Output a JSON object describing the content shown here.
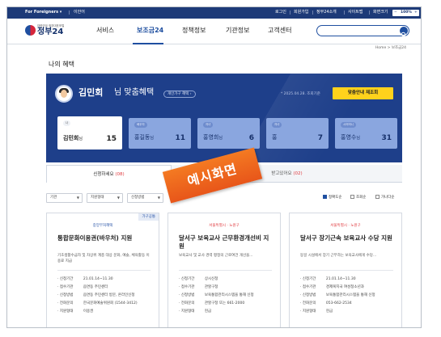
{
  "topbar": {
    "foreigners": "For Foreigners ▾",
    "easy": "이안어",
    "links": [
      "로그인",
      "회원가입",
      "정부24소개",
      "사이트맵"
    ],
    "zoom_label": "화면크기",
    "zoom_minus": "−",
    "zoom_value": "100%",
    "zoom_plus": "+"
  },
  "header": {
    "logo_small": "대한민국 정부대표포털",
    "logo_text": "정부24",
    "nav": [
      "서비스",
      "보조금24",
      "정책정보",
      "기관정보",
      "고객센터"
    ],
    "active_nav": "보조금24"
  },
  "breadcrumb": "Home > 보조금24",
  "page_title": "나의 혜택",
  "banner": {
    "name": "김민회",
    "suffix": "님 맞춤혜택",
    "badge": "개인가구 혜택 ›",
    "date": "* 2025.04.28. 조회기준",
    "button": "맞춤안내 재조회",
    "members": [
      {
        "tag": "나",
        "name": "김민회",
        "honorific": "님",
        "count": "15"
      },
      {
        "tag": "배우자",
        "name": "홍길동",
        "honorific": "님",
        "count": "11"
      },
      {
        "tag": "자녀",
        "name": "홍영희",
        "honorific": "님",
        "count": "6"
      },
      {
        "tag": "자녀",
        "name": "홍",
        "honorific": "",
        "count": "7"
      },
      {
        "tag": "시어머니",
        "name": "홍영수",
        "honorific": "님",
        "count": "31"
      }
    ]
  },
  "tabs": {
    "left": "신청하세요",
    "left_count": "(08)",
    "right": "받고있어요",
    "right_count": "(02)"
  },
  "stamp": "예시화면",
  "filters": [
    "기관",
    "지원형태",
    "신청방법"
  ],
  "checks": [
    {
      "label": "정확도순",
      "checked": true
    },
    {
      "label": "조회순",
      "checked": false
    },
    {
      "label": "가나다순",
      "checked": false
    }
  ],
  "cards": [
    {
      "badge": "가구공통",
      "org": "중앙부처혜택",
      "title": "통합문화이용권(바우처) 지원",
      "desc": "기초생활수급자 및 차상위 계층 대상 문화, 예술, 체육활동 이용료 지급",
      "rows": [
        {
          "k": "신청기간",
          "v": "21.01.14~11.30"
        },
        {
          "k": "접수기관",
          "v": "읍면동 주민센터"
        },
        {
          "k": "신청방법",
          "v": "읍면동 주민센터 방문, 온라인신청"
        },
        {
          "k": "전화문의",
          "v": "한국문화예술위원회 (1544-3412)"
        },
        {
          "k": "지원형태",
          "v": "이용권"
        }
      ]
    },
    {
      "badge": "",
      "org": "서울특별시 · 노원구",
      "title": "달서구 보육교사 근무환경개선비 지원",
      "desc": "보육교사 및 교사 경력 평정의 근로여건 개선을...",
      "rows": [
        {
          "k": "신청기간",
          "v": "상시신청"
        },
        {
          "k": "접수기관",
          "v": "관할구청"
        },
        {
          "k": "신청방법",
          "v": "보육통합관리시스템을 통해 신청"
        },
        {
          "k": "전화문의",
          "v": "관할구청 또는 661-2000"
        },
        {
          "k": "지원형태",
          "v": "현금"
        }
      ]
    },
    {
      "badge": "",
      "org": "서울특별시 · 노원구",
      "title": "달서구 장기근속 보육교사 수당 지원",
      "desc": "동일 시설에서 장기 근무하는 보육교사에게 수당...",
      "rows": [
        {
          "k": "신청기간",
          "v": "21.01.14~11.30"
        },
        {
          "k": "접수기관",
          "v": "경제복지국 여성청소년과"
        },
        {
          "k": "신청방법",
          "v": "보육통합관리시스템을 통해 신청"
        },
        {
          "k": "전화문의",
          "v": "053-662-2534"
        },
        {
          "k": "지원형태",
          "v": "현금"
        }
      ]
    }
  ],
  "colors": {
    "navy": "#1d3a78",
    "banner": "#1e3f8a",
    "accent_yellow": "#ffd21c",
    "stamp_orange": "#f16a1f",
    "count_red": "#e0393e"
  }
}
